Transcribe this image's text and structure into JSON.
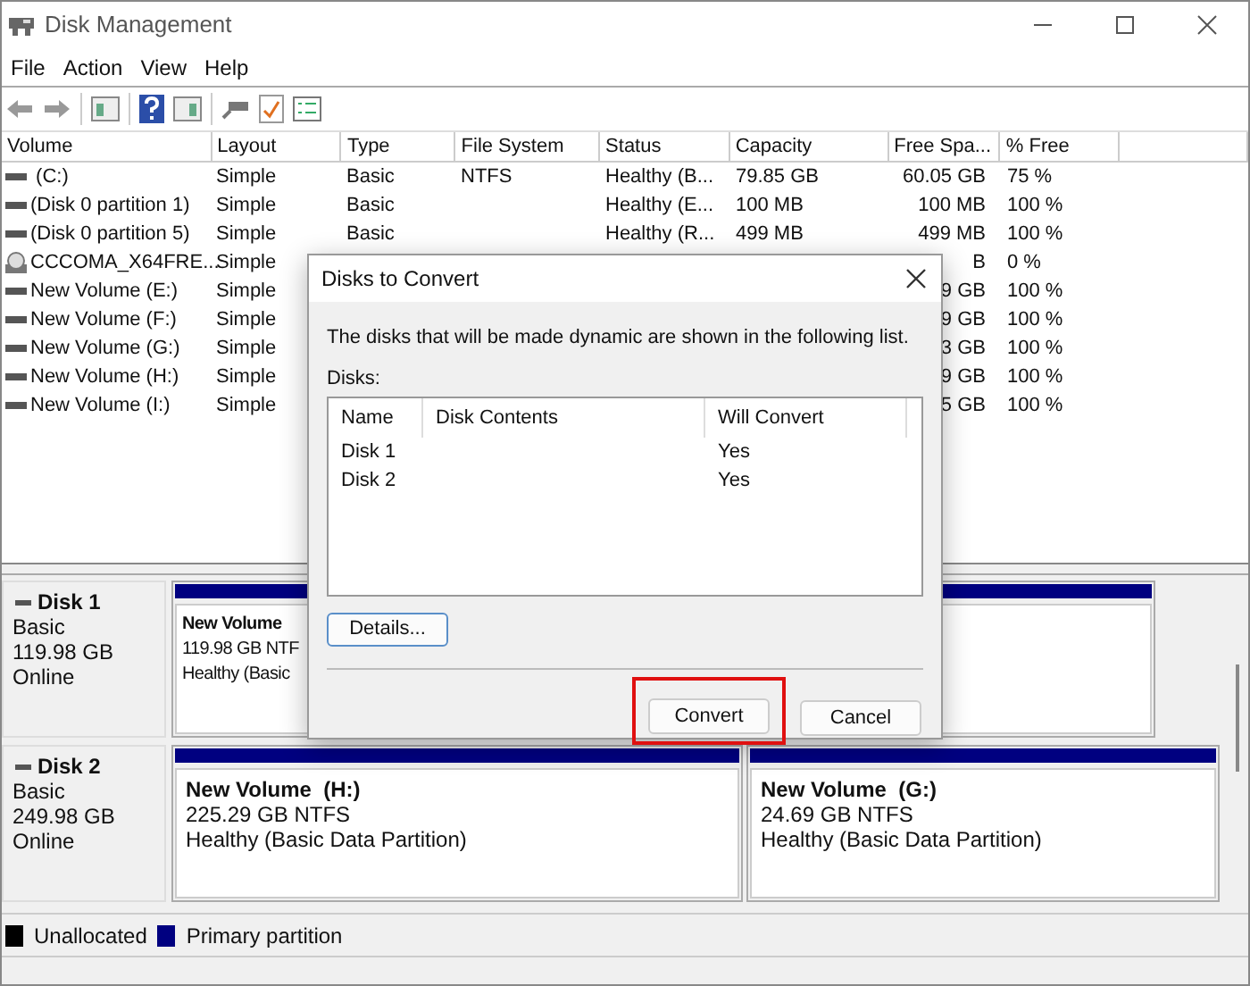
{
  "window": {
    "title": "Disk Management"
  },
  "menu": [
    "File",
    "Action",
    "View",
    "Help"
  ],
  "table": {
    "columns": [
      "Volume",
      "Layout",
      "Type",
      "File System",
      "Status",
      "Capacity",
      "Free Spa...",
      "% Free"
    ],
    "rows": [
      {
        "kind": "disk",
        "volume": " (C:)",
        "layout": "Simple",
        "type": "Basic",
        "file_system": "NTFS",
        "status": "Healthy (B...",
        "capacity": "79.85 GB",
        "free_space": "60.05 GB",
        "percent_free": "75 %"
      },
      {
        "kind": "disk",
        "volume": "(Disk 0 partition 1)",
        "layout": "Simple",
        "type": "Basic",
        "status": "Healthy (E...",
        "capacity": "100 MB",
        "free_space": "100 MB",
        "percent_free": "100 %"
      },
      {
        "kind": "disk",
        "volume": "(Disk 0 partition 5)",
        "layout": "Simple",
        "type": "Basic",
        "status": "Healthy (R...",
        "capacity": "499 MB",
        "free_space": "499 MB",
        "percent_free": "100 %"
      },
      {
        "kind": "optical",
        "volume": "CCCOMA_X64FRE...",
        "layout": "Simple",
        "free_space": "B",
        "percent_free": "0 %"
      },
      {
        "kind": "disk",
        "volume": "New Volume (E:)",
        "layout": "Simple",
        "free_space": "9 GB",
        "percent_free": "100 %"
      },
      {
        "kind": "disk",
        "volume": "New Volume (F:)",
        "layout": "Simple",
        "free_space": "9 GB",
        "percent_free": "100 %"
      },
      {
        "kind": "disk",
        "volume": "New Volume (G:)",
        "layout": "Simple",
        "free_space": "3 GB",
        "percent_free": "100 %"
      },
      {
        "kind": "disk",
        "volume": "New Volume (H:)",
        "layout": "Simple",
        "free_space": "9 GB",
        "percent_free": "100 %"
      },
      {
        "kind": "disk",
        "volume": "New Volume (I:)",
        "layout": "Simple",
        "free_space": "5 GB",
        "percent_free": "100 %"
      }
    ]
  },
  "disks": [
    {
      "name": "Disk 1",
      "type": "Basic",
      "size": "119.98 GB",
      "state": "Online",
      "partitions": [
        {
          "name": "New Volume",
          "size": "119.98 GB NTF",
          "status": "Healthy (Basic",
          "covered": true
        }
      ]
    },
    {
      "name": "Disk 2",
      "type": "Basic",
      "size": "249.98 GB",
      "state": "Online",
      "partitions": [
        {
          "name": "New Volume  (H:)",
          "size": "225.29 GB NTFS",
          "status": "Healthy (Basic Data Partition)",
          "covered": false
        },
        {
          "name": "New Volume  (G:)",
          "size": "24.69 GB NTFS",
          "status": "Healthy (Basic Data Partition)",
          "covered": false
        }
      ]
    }
  ],
  "legend": [
    {
      "label": "Unallocated",
      "color": "#000000"
    },
    {
      "label": "Primary partition",
      "color": "#000080"
    }
  ],
  "dialog": {
    "title": "Disks to Convert",
    "message": "The disks that will be made dynamic are shown in the following list.",
    "list_label": "Disks:",
    "columns": [
      "Name",
      "Disk Contents",
      "Will Convert"
    ],
    "rows": [
      {
        "name": "Disk 1",
        "will_convert": "Yes"
      },
      {
        "name": "Disk 2",
        "will_convert": "Yes"
      }
    ],
    "details_button": "Details...",
    "buttons": [
      {
        "label": "Convert",
        "highlighted": true
      },
      {
        "label": "Cancel",
        "highlighted": false
      }
    ]
  }
}
